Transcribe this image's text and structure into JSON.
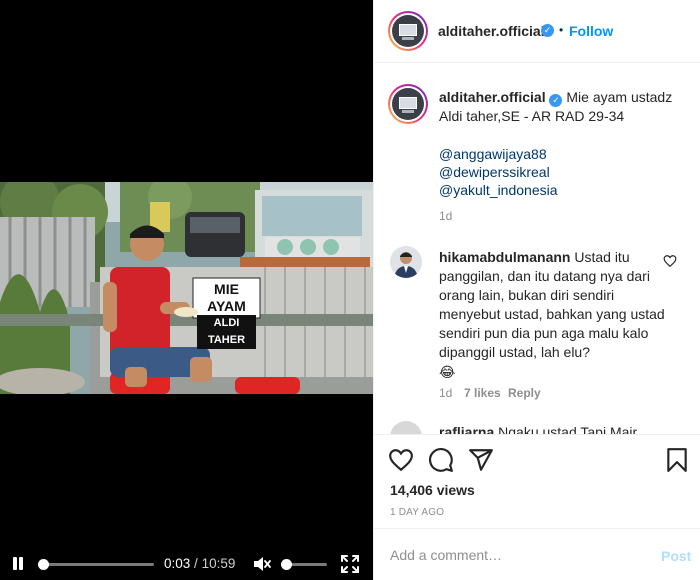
{
  "video": {
    "sign_line1": "MIE AYAM",
    "sign_line2": "ALDI TAHER",
    "current_time": "0:03",
    "separator": "/",
    "duration": "10:59",
    "progress_fraction": 0.005,
    "volume_fraction": 0.1
  },
  "header": {
    "username": "alditaher.official",
    "bullet": "•",
    "follow_label": "Follow"
  },
  "caption": {
    "username": "alditaher.official",
    "text": "Mie ayam ustadz Aldi taher,SE - AR RAD 29-34",
    "mentions": [
      "@anggawijaya88",
      "@dewiperssikreal",
      "@yakult_indonesia"
    ],
    "time": "1d"
  },
  "comments": [
    {
      "username": "hikamabdulmanann",
      "text": "Ustad itu panggilan, dan itu datang nya dari orang lain, bukan diri sendiri menyebut ustad, bahkan yang ustad sendiri pun dia pun aga malu kalo dipanggil ustad, lah elu?",
      "emoji": "😂",
      "time": "1d",
      "likes": "7 likes",
      "reply_label": "Reply"
    },
    {
      "username": "rafliarna",
      "text": "Ngaku ustad Tapi Mair"
    }
  ],
  "actions": {
    "views": "14,406 views",
    "date": "1 DAY AGO"
  },
  "add_comment": {
    "placeholder": "Add a comment…",
    "post_label": "Post"
  },
  "colors": {
    "link": "#0095f6",
    "mention": "#00376b",
    "verified": "#3897f0",
    "muted": "#8e8e8e",
    "post_disabled": "#b2dffc"
  },
  "icons": [
    "pause-icon",
    "volume-muted-icon",
    "fullscreen-icon",
    "heart-icon",
    "comment-icon",
    "share-icon",
    "bookmark-icon",
    "verified-icon"
  ]
}
